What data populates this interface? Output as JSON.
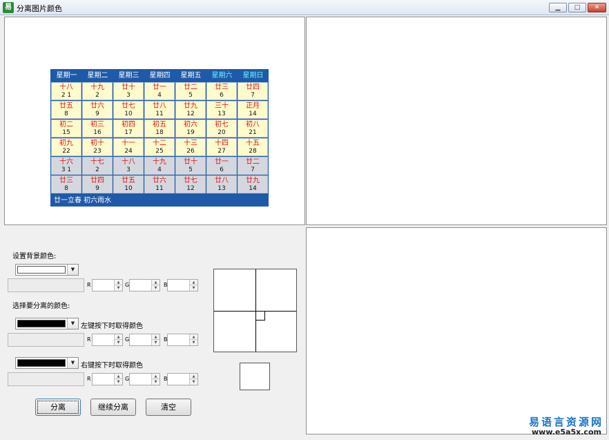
{
  "window": {
    "title": "分离图片颜色",
    "app_icon": "易",
    "minimize": "▁",
    "maximize": "□",
    "close": "✕"
  },
  "calendar": {
    "weekdays": [
      "星期一",
      "星期二",
      "星期三",
      "星期四",
      "星期五",
      "星期六",
      "星期日"
    ],
    "weeks": [
      [
        [
          "十八",
          "2 1"
        ],
        [
          "十九",
          "2"
        ],
        [
          "廿十",
          "3"
        ],
        [
          "廿一",
          "4"
        ],
        [
          "廿二",
          "5"
        ],
        [
          "廿三",
          "6"
        ],
        [
          "廿四",
          "7"
        ]
      ],
      [
        [
          "廿五",
          "8"
        ],
        [
          "廿六",
          "9"
        ],
        [
          "廿七",
          "10"
        ],
        [
          "廿八",
          "11"
        ],
        [
          "廿九",
          "12"
        ],
        [
          "三十",
          "13"
        ],
        [
          "正月",
          "14"
        ]
      ],
      [
        [
          "初二",
          "15"
        ],
        [
          "初三",
          "16"
        ],
        [
          "初四",
          "17"
        ],
        [
          "初五",
          "18"
        ],
        [
          "初六",
          "19"
        ],
        [
          "初七",
          "20"
        ],
        [
          "初八",
          "21"
        ]
      ],
      [
        [
          "初九",
          "22"
        ],
        [
          "初十",
          "23"
        ],
        [
          "十一",
          "24"
        ],
        [
          "十二",
          "25"
        ],
        [
          "十三",
          "26"
        ],
        [
          "十四",
          "27"
        ],
        [
          "十五",
          "28"
        ]
      ],
      [
        [
          "十六",
          "3 1"
        ],
        [
          "十七",
          "2"
        ],
        [
          "十八",
          "3"
        ],
        [
          "十九",
          "4"
        ],
        [
          "廿十",
          "5"
        ],
        [
          "廿一",
          "6"
        ],
        [
          "廿二",
          "7"
        ]
      ],
      [
        [
          "廿三",
          "8"
        ],
        [
          "廿四",
          "9"
        ],
        [
          "廿五",
          "10"
        ],
        [
          "廿六",
          "11"
        ],
        [
          "廿七",
          "12"
        ],
        [
          "廿八",
          "13"
        ],
        [
          "廿九",
          "14"
        ]
      ]
    ],
    "footer": "廿一立春   初六雨水",
    "colors": {
      "header": "#1e5aa8",
      "weekend": "#6ef0ff",
      "current_month_bg": "#fffbcc",
      "other_month_bg": "#d4d8de",
      "lunar_text": "#e01010"
    }
  },
  "controls": {
    "bg_label": "设置背景颜色:",
    "sep_label": "选择要分离的颜色:",
    "left_label": "左键按下时取得颜色",
    "right_label": "右键按下时取得颜色",
    "channels": [
      "R",
      "G",
      "B"
    ],
    "bg_color": "#ffffff",
    "left_color": "#000000",
    "right_color": "#000000",
    "arrow": "▼",
    "spin_up": "▲",
    "spin_down": "▼"
  },
  "buttons": {
    "separate": "分离",
    "continue": "继续分离",
    "clear": "清空"
  },
  "watermark": {
    "brand": "易语言资源网",
    "url": "www.e5a5x.com"
  }
}
